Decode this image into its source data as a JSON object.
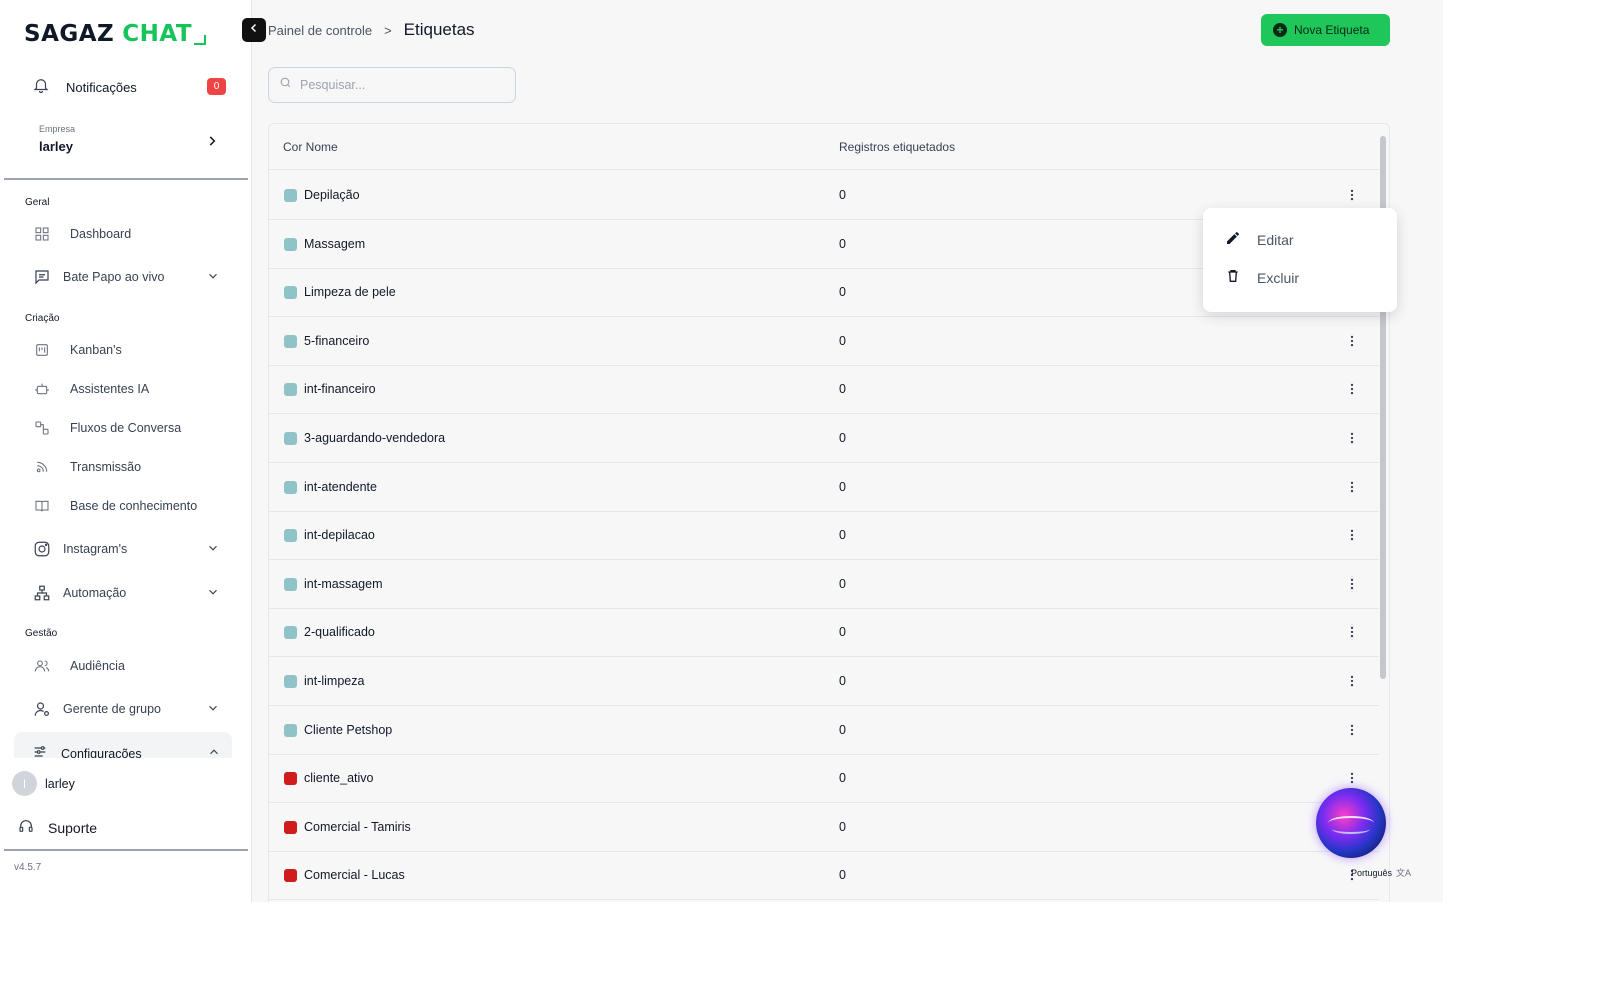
{
  "brand": {
    "name_part1": "SAGAZ",
    "name_part2": "CHAT",
    "accent": "#1fc65a"
  },
  "sidebar": {
    "notifications": {
      "label": "Notificações",
      "count": "0"
    },
    "company": {
      "caption": "Empresa",
      "name": "larley"
    },
    "sections": {
      "geral": "Geral",
      "criacao": "Criação",
      "gestao": "Gestão"
    },
    "items": {
      "dashboard": "Dashboard",
      "bate_papo": "Bate Papo ao vivo",
      "kanbans": "Kanban's",
      "assistentes": "Assistentes IA",
      "fluxos": "Fluxos de Conversa",
      "transmissao": "Transmissão",
      "base": "Base de conhecimento",
      "instagram": "Instagram's",
      "automacao": "Automação",
      "audiencia": "Audiência",
      "gerente": "Gerente de grupo",
      "configuracoes": "Configurações"
    },
    "user": {
      "initial": "l",
      "name": "larley"
    },
    "support": "Suporte",
    "version": "v4.5.7"
  },
  "header": {
    "breadcrumb_parent": "Painel de controle",
    "breadcrumb_sep": ">",
    "title": "Etiquetas",
    "new_button": "Nova Etiqueta"
  },
  "search": {
    "placeholder": "Pesquisar...",
    "value": ""
  },
  "table": {
    "columns": {
      "name": "Cor Nome",
      "count": "Registros etiquetados"
    },
    "rows": [
      {
        "name": "Depilação",
        "count": "0",
        "color": "#8fc3c7"
      },
      {
        "name": "Massagem",
        "count": "0",
        "color": "#8fc3c7"
      },
      {
        "name": "Limpeza de pele",
        "count": "0",
        "color": "#8fc3c7"
      },
      {
        "name": "5-financeiro",
        "count": "0",
        "color": "#8fc3c7"
      },
      {
        "name": "int-financeiro",
        "count": "0",
        "color": "#8fc3c7"
      },
      {
        "name": "3-aguardando-vendedora",
        "count": "0",
        "color": "#8fc3c7"
      },
      {
        "name": "int-atendente",
        "count": "0",
        "color": "#8fc3c7"
      },
      {
        "name": "int-depilacao",
        "count": "0",
        "color": "#8fc3c7"
      },
      {
        "name": "int-massagem",
        "count": "0",
        "color": "#8fc3c7"
      },
      {
        "name": "2-qualificado",
        "count": "0",
        "color": "#8fc3c7"
      },
      {
        "name": "int-limpeza",
        "count": "0",
        "color": "#8fc3c7"
      },
      {
        "name": "Cliente Petshop",
        "count": "0",
        "color": "#8fc3c7"
      },
      {
        "name": "cliente_ativo",
        "count": "0",
        "color": "#d01c1c"
      },
      {
        "name": "Comercial - Tamiris",
        "count": "0",
        "color": "#d01c1c"
      },
      {
        "name": "Comercial - Lucas",
        "count": "0",
        "color": "#d01c1c"
      }
    ]
  },
  "context_menu": {
    "edit": "Editar",
    "delete": "Excluir"
  },
  "language": "Português"
}
